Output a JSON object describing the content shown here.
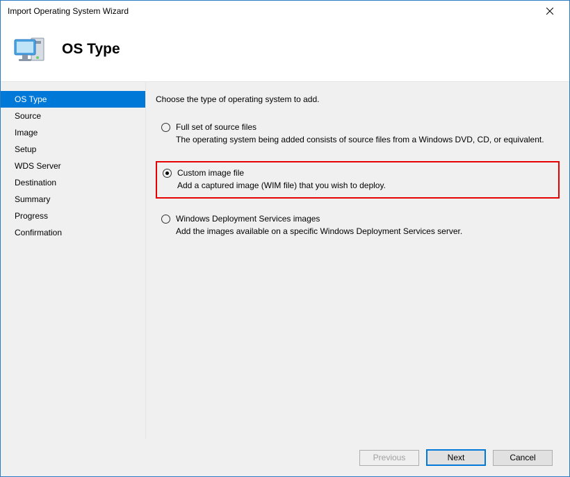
{
  "window": {
    "title": "Import Operating System Wizard"
  },
  "header": {
    "title": "OS Type"
  },
  "sidebar": {
    "items": [
      {
        "label": "OS Type",
        "selected": true
      },
      {
        "label": "Source",
        "selected": false
      },
      {
        "label": "Image",
        "selected": false
      },
      {
        "label": "Setup",
        "selected": false
      },
      {
        "label": "WDS Server",
        "selected": false
      },
      {
        "label": "Destination",
        "selected": false
      },
      {
        "label": "Summary",
        "selected": false
      },
      {
        "label": "Progress",
        "selected": false
      },
      {
        "label": "Confirmation",
        "selected": false
      }
    ]
  },
  "main": {
    "prompt": "Choose the type of operating system to add.",
    "options": [
      {
        "label": "Full set of source files",
        "desc": "The operating system being added consists of source files from a Windows DVD, CD, or equivalent.",
        "checked": false,
        "highlighted": false
      },
      {
        "label": "Custom image file",
        "desc": "Add a captured image (WIM file) that you wish to deploy.",
        "checked": true,
        "highlighted": true
      },
      {
        "label": "Windows Deployment Services images",
        "desc": "Add the images available on a specific Windows Deployment Services server.",
        "checked": false,
        "highlighted": false
      }
    ]
  },
  "footer": {
    "previous": "Previous",
    "next": "Next",
    "cancel": "Cancel"
  }
}
